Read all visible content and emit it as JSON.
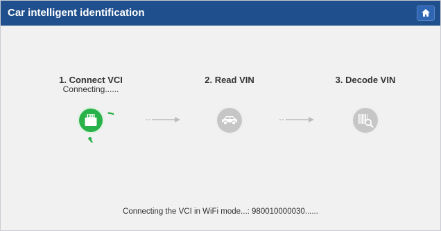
{
  "header": {
    "title": "Car intelligent identification",
    "home_icon": "home-icon"
  },
  "steps": [
    {
      "title": "1. Connect VCI",
      "subtitle": "Connecting......",
      "icon": "vci-device-icon",
      "state": "active"
    },
    {
      "title": "2. Read VIN",
      "subtitle": "",
      "icon": "car-icon",
      "state": "pending"
    },
    {
      "title": "3. Decode VIN",
      "subtitle": "",
      "icon": "barcode-search-icon",
      "state": "pending"
    }
  ],
  "status_text": "Connecting the VCI in WiFi mode...: 980010000030......",
  "colors": {
    "header_bg": "#1f4f8c",
    "accent_green": "#2ab24a",
    "pending_gray": "#c6c6c6",
    "background": "#f1f1f1"
  }
}
